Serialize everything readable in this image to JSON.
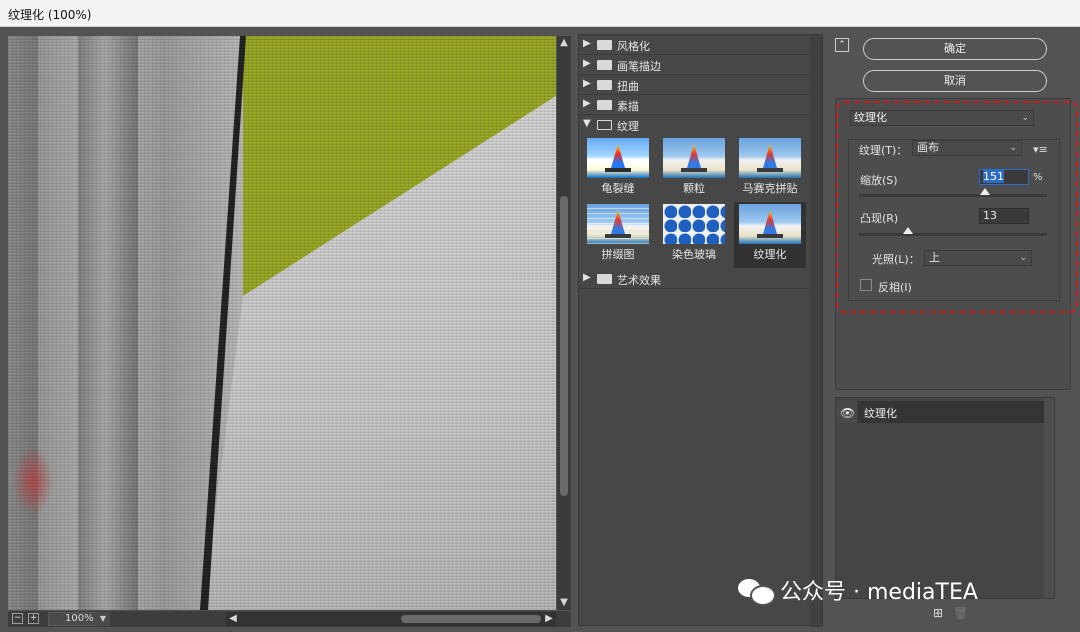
{
  "window": {
    "title": "纹理化 (100%)"
  },
  "preview": {
    "zoom": "100%",
    "zoom_out_icon": "minus-icon",
    "zoom_in_icon": "plus-icon"
  },
  "gallery": {
    "categories": [
      {
        "label": "风格化",
        "expanded": false
      },
      {
        "label": "画笔描边",
        "expanded": false
      },
      {
        "label": "扭曲",
        "expanded": false
      },
      {
        "label": "素描",
        "expanded": false
      },
      {
        "label": "纹理",
        "expanded": true
      },
      {
        "label": "艺术效果",
        "expanded": false
      }
    ],
    "filters": [
      {
        "label": "龟裂缝",
        "selected": false
      },
      {
        "label": "颗粒",
        "selected": false
      },
      {
        "label": "马赛克拼贴",
        "selected": false
      },
      {
        "label": "拼缀图",
        "selected": false
      },
      {
        "label": "染色玻璃",
        "selected": false
      },
      {
        "label": "纹理化",
        "selected": true
      }
    ]
  },
  "actions": {
    "ok": "确定",
    "cancel": "取消"
  },
  "settings": {
    "filter_select": "纹理化",
    "texture_label": "纹理(T)：",
    "texture_value": "画布",
    "scale_label": "缩放(S)",
    "scale_value": "151",
    "scale_unit": "%",
    "scale_level": 0.67,
    "relief_label": "凸现(R)",
    "relief_value": "13",
    "relief_level": 0.26,
    "light_label": "光照(L)：",
    "light_value": "上",
    "invert_label": "反相(I)",
    "invert_checked": false
  },
  "layers": {
    "items": [
      {
        "name": "纹理化",
        "visible": true
      }
    ],
    "new_icon": "new-layer-icon",
    "delete_icon": "trash-icon"
  },
  "watermark": {
    "text": "公众号 · mediaTEA"
  }
}
